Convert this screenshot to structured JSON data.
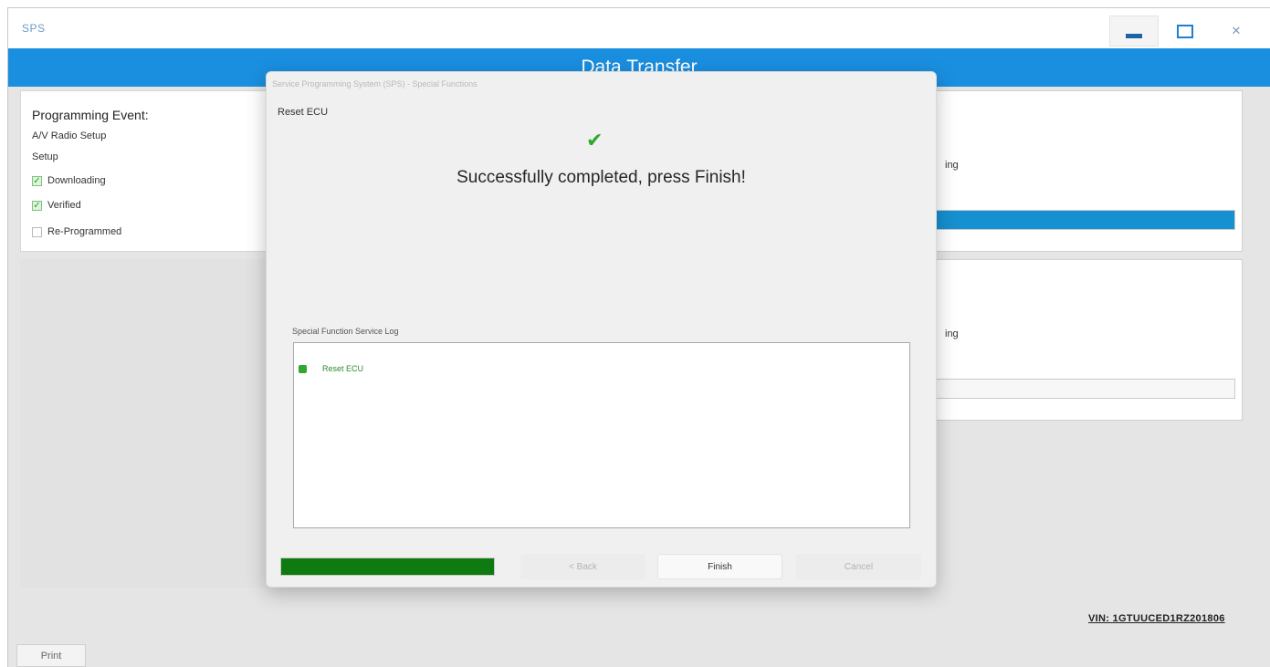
{
  "window": {
    "app_title": "SPS",
    "banner_title": "Data Transfer"
  },
  "left_panel": {
    "heading": "Programming Event:",
    "line1": "A/V Radio Setup",
    "line2": "Setup",
    "steps": [
      {
        "label": "Downloading",
        "checked": true
      },
      {
        "label": "Verified",
        "checked": true
      },
      {
        "label": "Re-Programmed",
        "checked": false
      }
    ]
  },
  "right_panel": {
    "card1_text": "ing",
    "card1_progress": 1.0,
    "card2_text": "ing",
    "card2_progress": 0.0
  },
  "dialog": {
    "title": "Service Programming System (SPS) - Special Functions",
    "step_name": "Reset ECU",
    "success_message": "Successfully completed, press Finish!",
    "log_label": "Special Function Service Log",
    "log_entries": [
      {
        "text": "Reset ECU",
        "status_color": "#2ea82e"
      }
    ],
    "progress": 1.0,
    "buttons": {
      "back": "< Back",
      "finish": "Finish",
      "cancel": "Cancel"
    }
  },
  "footer": {
    "vin": "VIN: 1GTUUCED1RZ201806",
    "print_label": "Print"
  },
  "colors": {
    "banner": "#1a8fe0",
    "progress_blue": "#1590d0",
    "progress_green": "#0f7a0f",
    "success": "#2ea82e"
  }
}
